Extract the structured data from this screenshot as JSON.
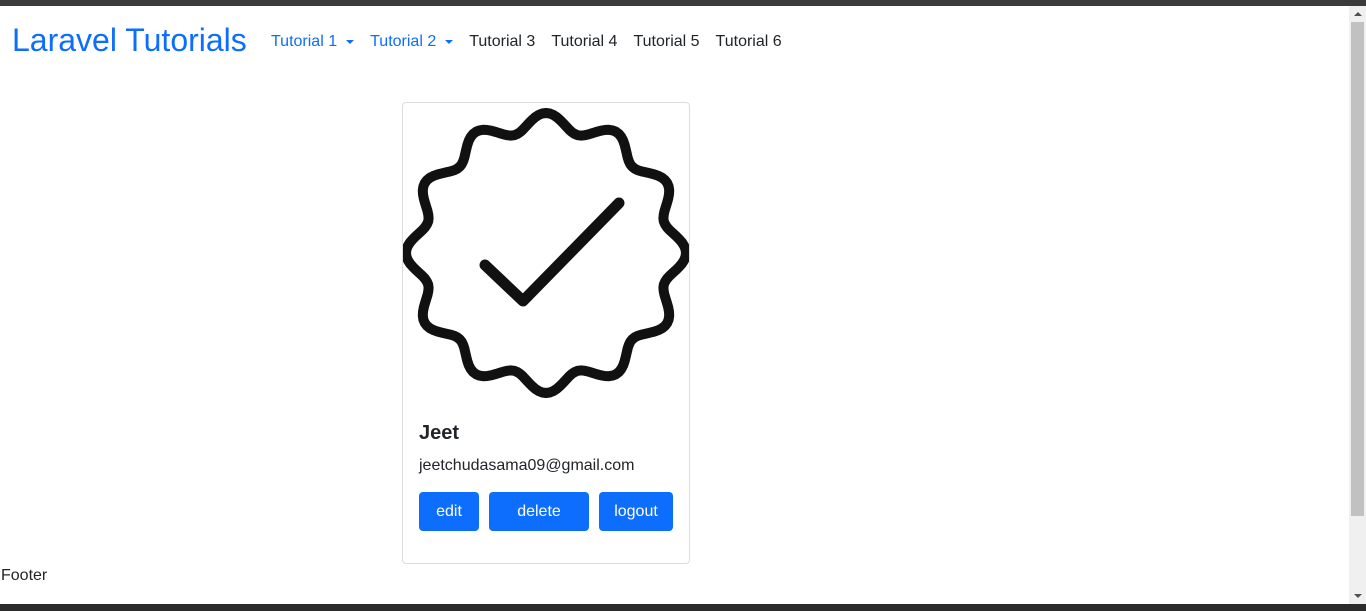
{
  "navbar": {
    "brand": "Laravel Tutorials",
    "items": [
      {
        "label": "Tutorial 1",
        "dropdown": true
      },
      {
        "label": "Tutorial 2",
        "dropdown": true
      },
      {
        "label": "Tutorial 3",
        "dropdown": false
      },
      {
        "label": "Tutorial 4",
        "dropdown": false
      },
      {
        "label": "Tutorial 5",
        "dropdown": false
      },
      {
        "label": "Tutorial 6",
        "dropdown": false
      }
    ]
  },
  "profile_card": {
    "image_icon": "verified-badge-icon",
    "name": "Jeet",
    "email": "jeetchudasama09@gmail.com",
    "buttons": {
      "edit": "edit",
      "delete": "delete",
      "logout": "logout"
    }
  },
  "footer": {
    "text": "Footer"
  },
  "colors": {
    "primary": "#0d6efd",
    "text": "#212529",
    "card_border": "#dcdcdc"
  }
}
